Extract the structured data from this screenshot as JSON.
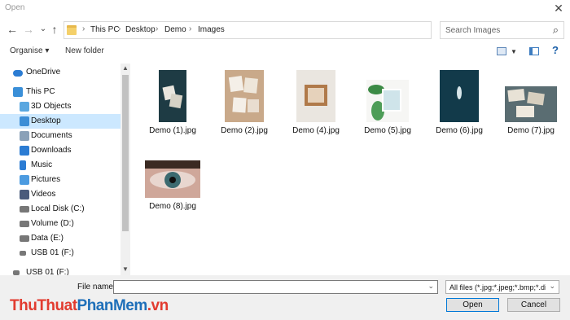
{
  "window": {
    "title": "Open"
  },
  "nav": {
    "back": "←",
    "forward": "→",
    "recent": "⌄",
    "up": "↑"
  },
  "address": {
    "crumbs": [
      "This PC",
      "Desktop",
      "Demo",
      "Images"
    ],
    "separator": "›"
  },
  "search": {
    "placeholder": "Search Images"
  },
  "toolbar": {
    "organise_label": "Organise ▾",
    "new_folder_label": "New folder"
  },
  "sidebar": {
    "items": [
      {
        "label": "OneDrive",
        "icon": "cloud-icon",
        "color": "#2b7cd3"
      },
      {
        "label": "This PC",
        "icon": "computer-icon",
        "color": "#3a8fd8"
      },
      {
        "label": "3D Objects",
        "icon": "cube-icon",
        "color": "#5aa7e0"
      },
      {
        "label": "Desktop",
        "icon": "desktop-icon",
        "color": "#3d8ed6",
        "selected": true
      },
      {
        "label": "Documents",
        "icon": "document-icon",
        "color": "#8aa1b8"
      },
      {
        "label": "Downloads",
        "icon": "download-icon",
        "color": "#2b7cd3"
      },
      {
        "label": "Music",
        "icon": "music-icon",
        "color": "#2b7cd3"
      },
      {
        "label": "Pictures",
        "icon": "pictures-icon",
        "color": "#4c9be0"
      },
      {
        "label": "Videos",
        "icon": "video-icon",
        "color": "#4a5b7c"
      },
      {
        "label": "Local Disk (C:)",
        "icon": "drive-icon",
        "color": "#777777"
      },
      {
        "label": "Volume (D:)",
        "icon": "drive-icon",
        "color": "#777777"
      },
      {
        "label": "Data (E:)",
        "icon": "drive-icon",
        "color": "#777777"
      },
      {
        "label": "USB 01 (F:)",
        "icon": "usb-drive-icon",
        "color": "#777777"
      },
      {
        "label": "USB 01 (F:)",
        "icon": "usb-drive-icon",
        "color": "#777777"
      }
    ]
  },
  "files": [
    {
      "name": "Demo (1).jpg",
      "colors": [
        "#1e3b44",
        "#e9e6de"
      ]
    },
    {
      "name": "Demo (2).jpg",
      "colors": [
        "#c9a98a",
        "#f4efe8"
      ]
    },
    {
      "name": "Demo (4).jpg",
      "colors": [
        "#eae6e0",
        "#b07a4a"
      ]
    },
    {
      "name": "Demo (5).jpg",
      "colors": [
        "#f6f6f4",
        "#3b8a45"
      ]
    },
    {
      "name": "Demo (6).jpg",
      "colors": [
        "#123a4a",
        "#d8e6ea"
      ]
    },
    {
      "name": "Demo (7).jpg",
      "colors": [
        "#5a6d72",
        "#e8e2d6"
      ]
    },
    {
      "name": "Demo (8).jpg",
      "colors": [
        "#3b2a22",
        "#cfa79a"
      ]
    }
  ],
  "bottom": {
    "file_name_label": "File name:",
    "file_name_value": "",
    "filter": "All files (*.jpg;*.jpeg;*.bmp;*.dil",
    "open_label": "Open",
    "cancel_label": "Cancel"
  },
  "watermark": {
    "part1": "ThuThuat",
    "part2": "PhanMem",
    "part3": ".vn"
  }
}
